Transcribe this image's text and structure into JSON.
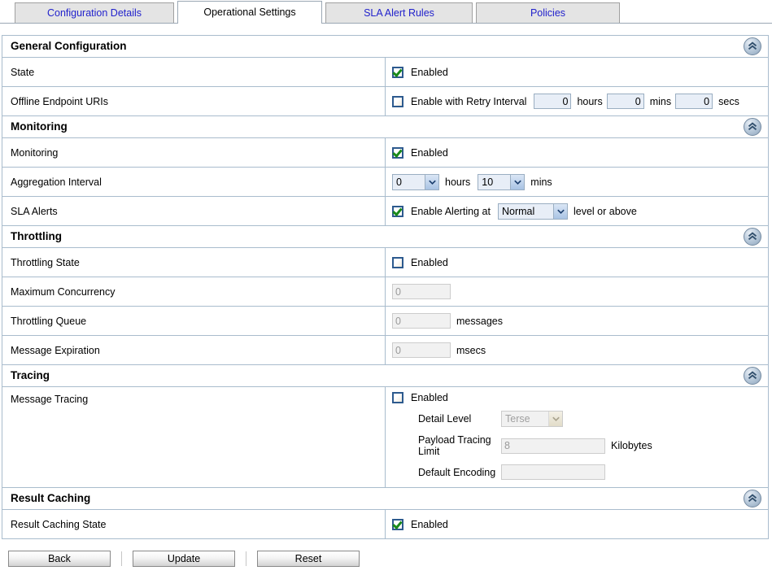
{
  "tabs": [
    {
      "label": "Configuration Details",
      "active": false
    },
    {
      "label": "Operational Settings",
      "active": true
    },
    {
      "label": "SLA Alert Rules",
      "active": false
    },
    {
      "label": "Policies",
      "active": false
    }
  ],
  "colors": {
    "section_header_bg": "#ece9dd",
    "grid_border": "#a9bccd",
    "input_enabled_bg": "#e8eef7",
    "checkbox_border": "#2d5a8e",
    "check_green": "#1a8a1a",
    "tab_link": "#2222cc"
  },
  "icons": {
    "collapse": "chevron-double-up-icon",
    "select_arrow": "chevron-down-icon"
  },
  "sections": {
    "general": {
      "title": "General Configuration",
      "state": {
        "label": "State",
        "checkbox_label": "Enabled",
        "checked": true
      },
      "offline": {
        "label": "Offline Endpoint URIs",
        "checkbox_label": "Enable with Retry Interval",
        "checked": false,
        "hours_value": "0",
        "hours_unit": "hours",
        "mins_value": "0",
        "mins_unit": "mins",
        "secs_value": "0",
        "secs_unit": "secs"
      }
    },
    "monitoring": {
      "title": "Monitoring",
      "monitoring": {
        "label": "Monitoring",
        "checkbox_label": "Enabled",
        "checked": true
      },
      "aggregation": {
        "label": "Aggregation Interval",
        "hours_value": "0",
        "hours_unit": "hours",
        "mins_value": "10",
        "mins_unit": "mins"
      },
      "sla_alerts": {
        "label": "SLA Alerts",
        "checkbox_label": "Enable Alerting at",
        "checked": true,
        "level_value": "Normal",
        "suffix": "level or above"
      }
    },
    "throttling": {
      "title": "Throttling",
      "state": {
        "label": "Throttling State",
        "checkbox_label": "Enabled",
        "checked": false
      },
      "max_concurrency": {
        "label": "Maximum Concurrency",
        "value": "0",
        "unit": ""
      },
      "queue": {
        "label": "Throttling Queue",
        "value": "0",
        "unit": "messages"
      },
      "expiration": {
        "label": "Message Expiration",
        "value": "0",
        "unit": "msecs"
      }
    },
    "tracing": {
      "title": "Tracing",
      "message_tracing": {
        "label": "Message Tracing",
        "checkbox_label": "Enabled",
        "checked": false
      },
      "detail_level": {
        "label": "Detail Level",
        "value": "Terse"
      },
      "payload_limit": {
        "label": "Payload Tracing Limit",
        "value": "8",
        "unit": "Kilobytes"
      },
      "default_encoding": {
        "label": "Default Encoding",
        "value": ""
      }
    },
    "result_caching": {
      "title": "Result Caching",
      "state": {
        "label": "Result Caching State",
        "checkbox_label": "Enabled",
        "checked": true
      }
    }
  },
  "buttons": {
    "back": "Back",
    "update": "Update",
    "reset": "Reset"
  }
}
